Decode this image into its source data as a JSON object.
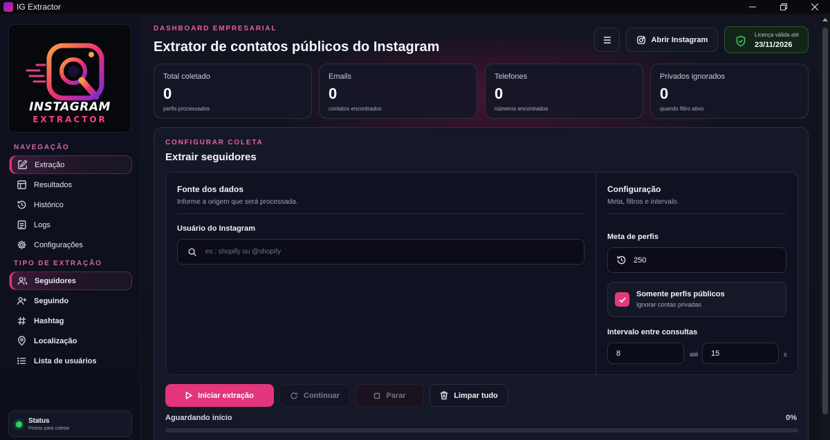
{
  "window": {
    "title": "IG Extractor"
  },
  "sidebar": {
    "logo": {
      "title": "INSTAGRAM",
      "subtitle": "EXTRACTOR"
    },
    "nav_section_label": "NAVEGAÇÃO",
    "nav_items": [
      {
        "label": "Extração",
        "icon": "edit-icon",
        "active": true
      },
      {
        "label": "Resultados",
        "icon": "layout-icon",
        "active": false
      },
      {
        "label": "Histórico",
        "icon": "history-icon",
        "active": false
      },
      {
        "label": "Logs",
        "icon": "file-list-icon",
        "active": false
      },
      {
        "label": "Configurações",
        "icon": "gear-icon",
        "active": false
      }
    ],
    "type_section_label": "TIPO DE EXTRAÇÃO",
    "type_items": [
      {
        "label": "Seguidores",
        "icon": "users-icon",
        "active": true
      },
      {
        "label": "Seguindo",
        "icon": "user-plus-icon",
        "active": false
      },
      {
        "label": "Hashtag",
        "icon": "hashtag-icon",
        "active": false
      },
      {
        "label": "Localização",
        "icon": "map-pin-icon",
        "active": false
      },
      {
        "label": "Lista de usuários",
        "icon": "list-icon",
        "active": false
      }
    ],
    "status": {
      "title": "Status",
      "subtitle": "Pronto para coletar",
      "color": "#27d35f"
    }
  },
  "header": {
    "eyebrow": "DASHBOARD EMPRESARIAL",
    "title": "Extrator de contatos públicos do Instagram",
    "open_instagram_label": "Abrir Instagram",
    "license_label": "Licença válida até",
    "license_date": "23/11/2026"
  },
  "stats": [
    {
      "label": "Total coletado",
      "value": "0",
      "sub": "perfis processados"
    },
    {
      "label": "Emails",
      "value": "0",
      "sub": "contatos encontrados"
    },
    {
      "label": "Telefones",
      "value": "0",
      "sub": "números encontrados"
    },
    {
      "label": "Privados ignorados",
      "value": "0",
      "sub": "quando filtro ativo"
    }
  ],
  "config": {
    "eyebrow": "CONFIGURAR COLETA",
    "title": "Extrair seguidores",
    "source": {
      "title": "Fonte dos dados",
      "subtitle": "Informe a origem que será processada.",
      "user_label": "Usuário do Instagram",
      "user_value": "",
      "user_placeholder": "ex.: shopify ou @shopify"
    },
    "settings": {
      "title": "Configuração",
      "subtitle": "Meta, filtros e intervalo.",
      "goal_label": "Meta de perfis",
      "goal_value": "250",
      "public_only_title": "Somente perfis públicos",
      "public_only_sub": "Ignorar contas privadas",
      "public_only_checked": true,
      "interval_label": "Intervalo entre consultas",
      "interval_from": "8",
      "interval_sep": "até",
      "interval_to": "15",
      "interval_unit": "s"
    },
    "actions": {
      "start": "Iniciar extração",
      "continue": "Continuar",
      "stop": "Parar",
      "clear": "Limpar tudo"
    },
    "progress": {
      "label": "Aguardando início",
      "percent_label": "0%",
      "fraction": 0
    }
  },
  "colors": {
    "accent": "#e3357b",
    "license_bg": "#132418",
    "status_green": "#27d35f"
  }
}
